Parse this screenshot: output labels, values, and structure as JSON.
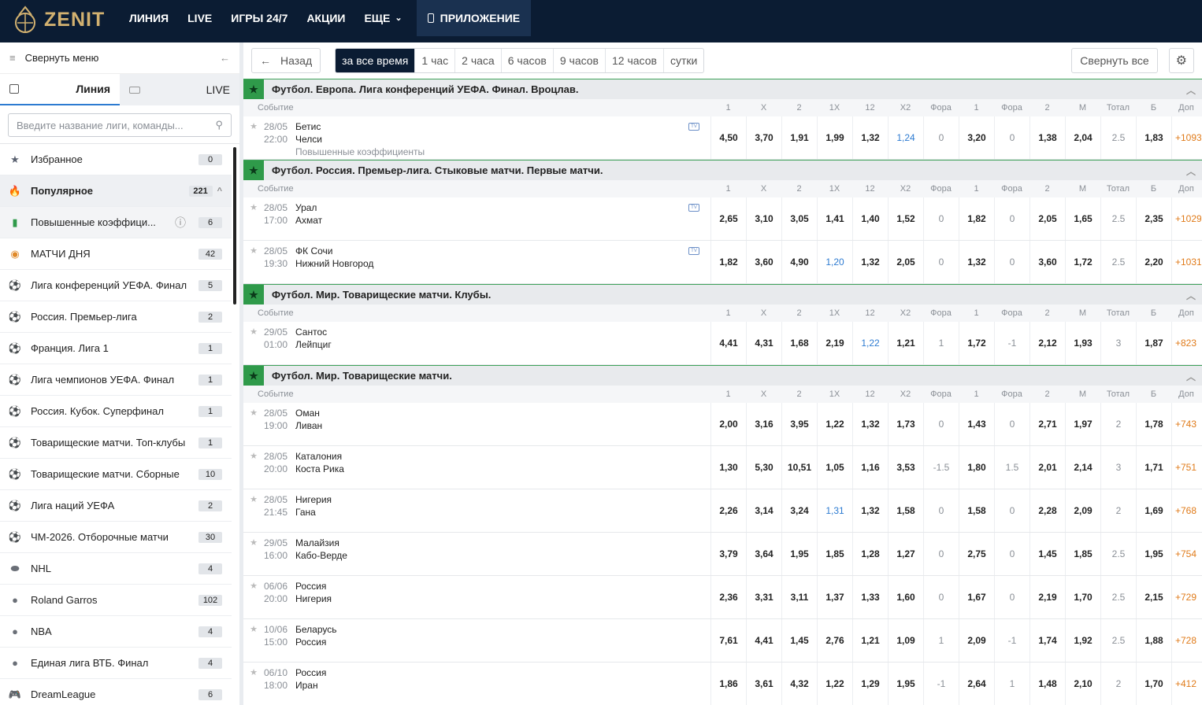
{
  "brand": "ZENIT",
  "nav": [
    "ЛИНИЯ",
    "LIVE",
    "ИГРЫ 24/7",
    "АКЦИИ",
    "ЕЩЕ",
    "ПРИЛОЖЕНИЕ"
  ],
  "sidebar": {
    "collapse": "Свернуть меню",
    "tabs": [
      "Линия",
      "LIVE"
    ],
    "search_placeholder": "Введите название лиги, команды...",
    "items": [
      {
        "label": "Избранное",
        "count": "0",
        "icon": "star-icon"
      },
      {
        "label": "Популярное",
        "count": "221",
        "icon": "fire-icon"
      },
      {
        "label": "Повышенные коэффици...",
        "count": "6",
        "icon": "chart-icon"
      },
      {
        "label": "МАТЧИ ДНЯ",
        "count": "42",
        "icon": "medal-icon"
      },
      {
        "label": "Лига конференций УЕФА. Финал",
        "count": "5",
        "icon": "soccer-ball-icon"
      },
      {
        "label": "Россия. Премьер-лига",
        "count": "2",
        "icon": "soccer-ball-icon"
      },
      {
        "label": "Франция. Лига 1",
        "count": "1",
        "icon": "soccer-ball-icon"
      },
      {
        "label": "Лига чемпионов УЕФА. Финал",
        "count": "1",
        "icon": "soccer-ball-icon"
      },
      {
        "label": "Россия. Кубок. Суперфинал",
        "count": "1",
        "icon": "soccer-ball-icon"
      },
      {
        "label": "Товарищеские матчи. Топ-клубы",
        "count": "1",
        "icon": "soccer-ball-icon"
      },
      {
        "label": "Товарищеские матчи. Сборные",
        "count": "10",
        "icon": "soccer-ball-icon"
      },
      {
        "label": "Лига наций УЕФА",
        "count": "2",
        "icon": "soccer-ball-icon"
      },
      {
        "label": "ЧМ-2026. Отборочные матчи",
        "count": "30",
        "icon": "soccer-ball-icon"
      },
      {
        "label": "NHL",
        "count": "4",
        "icon": "puck-icon"
      },
      {
        "label": "Roland Garros",
        "count": "102",
        "icon": "tennis-ball-icon"
      },
      {
        "label": "NBA",
        "count": "4",
        "icon": "basketball-icon"
      },
      {
        "label": "Единая лига ВТБ. Финал",
        "count": "4",
        "icon": "basketball-icon"
      },
      {
        "label": "DreamLeague",
        "count": "6",
        "icon": "gamepad-icon"
      }
    ]
  },
  "toolbar": {
    "back": "Назад",
    "periods": [
      "за все время",
      "1 час",
      "2 часа",
      "6 часов",
      "9 часов",
      "12 часов",
      "сутки"
    ],
    "collapse_all": "Свернуть все"
  },
  "columns": [
    "Событие",
    "1",
    "X",
    "2",
    "1X",
    "12",
    "X2",
    "Фора",
    "1",
    "Фора",
    "2",
    "М",
    "Тотал",
    "Б",
    "Доп"
  ],
  "leagues": [
    {
      "title": "Футбол. Европа. Лига конференций УЕФА. Финал. Вроцлав.",
      "events": [
        {
          "date": "28/05",
          "time": "22:00",
          "home": "Бетис",
          "away": "Челси",
          "note": "Повышенные коэффициенты",
          "tv": true,
          "odds": [
            "4,50",
            "3,70",
            "1,91",
            "1,99",
            "1,32",
            "1,24",
            "0",
            "3,20",
            "0",
            "1,38",
            "2,04",
            "2.5",
            "1,83",
            "+1093"
          ],
          "blue": [
            5
          ]
        }
      ]
    },
    {
      "title": "Футбол. Россия. Премьер-лига. Стыковые матчи. Первые матчи.",
      "events": [
        {
          "date": "28/05",
          "time": "17:00",
          "home": "Урал",
          "away": "Ахмат",
          "tv": true,
          "odds": [
            "2,65",
            "3,10",
            "3,05",
            "1,41",
            "1,40",
            "1,52",
            "0",
            "1,82",
            "0",
            "2,05",
            "1,65",
            "2.5",
            "2,35",
            "+1029"
          ],
          "blue": []
        },
        {
          "date": "28/05",
          "time": "19:30",
          "home": "ФК Сочи",
          "away": "Нижний Новгород",
          "tv": true,
          "odds": [
            "1,82",
            "3,60",
            "4,90",
            "1,20",
            "1,32",
            "2,05",
            "0",
            "1,32",
            "0",
            "3,60",
            "1,72",
            "2.5",
            "2,20",
            "+1031"
          ],
          "blue": [
            3
          ]
        }
      ]
    },
    {
      "title": "Футбол. Мир. Товарищеские матчи. Клубы.",
      "events": [
        {
          "date": "29/05",
          "time": "01:00",
          "home": "Сантос",
          "away": "Лейпциг",
          "odds": [
            "4,41",
            "4,31",
            "1,68",
            "2,19",
            "1,22",
            "1,21",
            "1",
            "1,72",
            "-1",
            "2,12",
            "1,93",
            "3",
            "1,87",
            "+823"
          ],
          "blue": [
            4
          ]
        }
      ]
    },
    {
      "title": "Футбол. Мир. Товарищеские матчи.",
      "events": [
        {
          "date": "28/05",
          "time": "19:00",
          "home": "Оман",
          "away": "Ливан",
          "odds": [
            "2,00",
            "3,16",
            "3,95",
            "1,22",
            "1,32",
            "1,73",
            "0",
            "1,43",
            "0",
            "2,71",
            "1,97",
            "2",
            "1,78",
            "+743"
          ],
          "blue": []
        },
        {
          "date": "28/05",
          "time": "20:00",
          "home": "Каталония",
          "away": "Коста Рика",
          "odds": [
            "1,30",
            "5,30",
            "10,51",
            "1,05",
            "1,16",
            "3,53",
            "-1.5",
            "1,80",
            "1.5",
            "2,01",
            "2,14",
            "3",
            "1,71",
            "+751"
          ],
          "blue": []
        },
        {
          "date": "28/05",
          "time": "21:45",
          "home": "Нигерия",
          "away": "Гана",
          "odds": [
            "2,26",
            "3,14",
            "3,24",
            "1,31",
            "1,32",
            "1,58",
            "0",
            "1,58",
            "0",
            "2,28",
            "2,09",
            "2",
            "1,69",
            "+768"
          ],
          "blue": [
            3
          ]
        },
        {
          "date": "29/05",
          "time": "16:00",
          "home": "Малайзия",
          "away": "Кабо-Верде",
          "odds": [
            "3,79",
            "3,64",
            "1,95",
            "1,85",
            "1,28",
            "1,27",
            "0",
            "2,75",
            "0",
            "1,45",
            "1,85",
            "2.5",
            "1,95",
            "+754"
          ],
          "blue": []
        },
        {
          "date": "06/06",
          "time": "20:00",
          "home": "Россия",
          "away": "Нигерия",
          "odds": [
            "2,36",
            "3,31",
            "3,11",
            "1,37",
            "1,33",
            "1,60",
            "0",
            "1,67",
            "0",
            "2,19",
            "1,70",
            "2.5",
            "2,15",
            "+729"
          ],
          "blue": []
        },
        {
          "date": "10/06",
          "time": "15:00",
          "home": "Беларусь",
          "away": "Россия",
          "odds": [
            "7,61",
            "4,41",
            "1,45",
            "2,76",
            "1,21",
            "1,09",
            "1",
            "2,09",
            "-1",
            "1,74",
            "1,92",
            "2.5",
            "1,88",
            "+728"
          ],
          "blue": []
        },
        {
          "date": "06/10",
          "time": "18:00",
          "home": "Россия",
          "away": "Иран",
          "odds": [
            "1,86",
            "3,61",
            "4,32",
            "1,22",
            "1,29",
            "1,95",
            "-1",
            "2,64",
            "1",
            "1,48",
            "2,10",
            "2",
            "1,70",
            "+412"
          ],
          "blue": []
        }
      ]
    }
  ]
}
